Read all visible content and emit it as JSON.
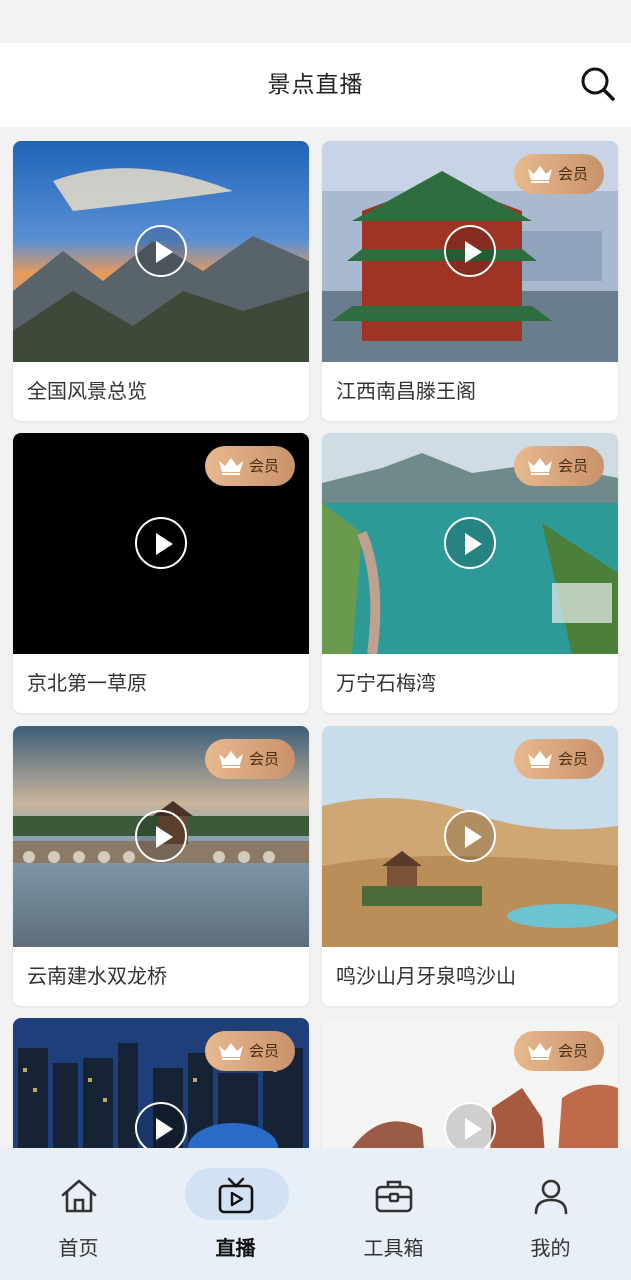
{
  "header": {
    "title": "景点直播",
    "search_icon": "search-icon"
  },
  "member_badge_label": "会员",
  "cards": [
    {
      "name": "全国风景总览",
      "member": false
    },
    {
      "name": "江西南昌滕王阁",
      "member": true
    },
    {
      "name": "京北第一草原",
      "member": true
    },
    {
      "name": "万宁石梅湾",
      "member": true
    },
    {
      "name": "云南建水双龙桥",
      "member": true
    },
    {
      "name": "鸣沙山月牙泉鸣沙山",
      "member": true
    },
    {
      "name": "",
      "member": true
    },
    {
      "name": "",
      "member": true
    }
  ],
  "tabs": [
    {
      "label": "首页",
      "icon": "home-icon",
      "active": false
    },
    {
      "label": "直播",
      "icon": "tv-icon",
      "active": true
    },
    {
      "label": "工具箱",
      "icon": "toolbox-icon",
      "active": false
    },
    {
      "label": "我的",
      "icon": "profile-icon",
      "active": false
    }
  ],
  "colors": {
    "badge_start": "#e8b98e",
    "badge_end": "#c9926a",
    "tabbar_bg": "#e9eff7",
    "active_pill": "#d2e1f3"
  }
}
